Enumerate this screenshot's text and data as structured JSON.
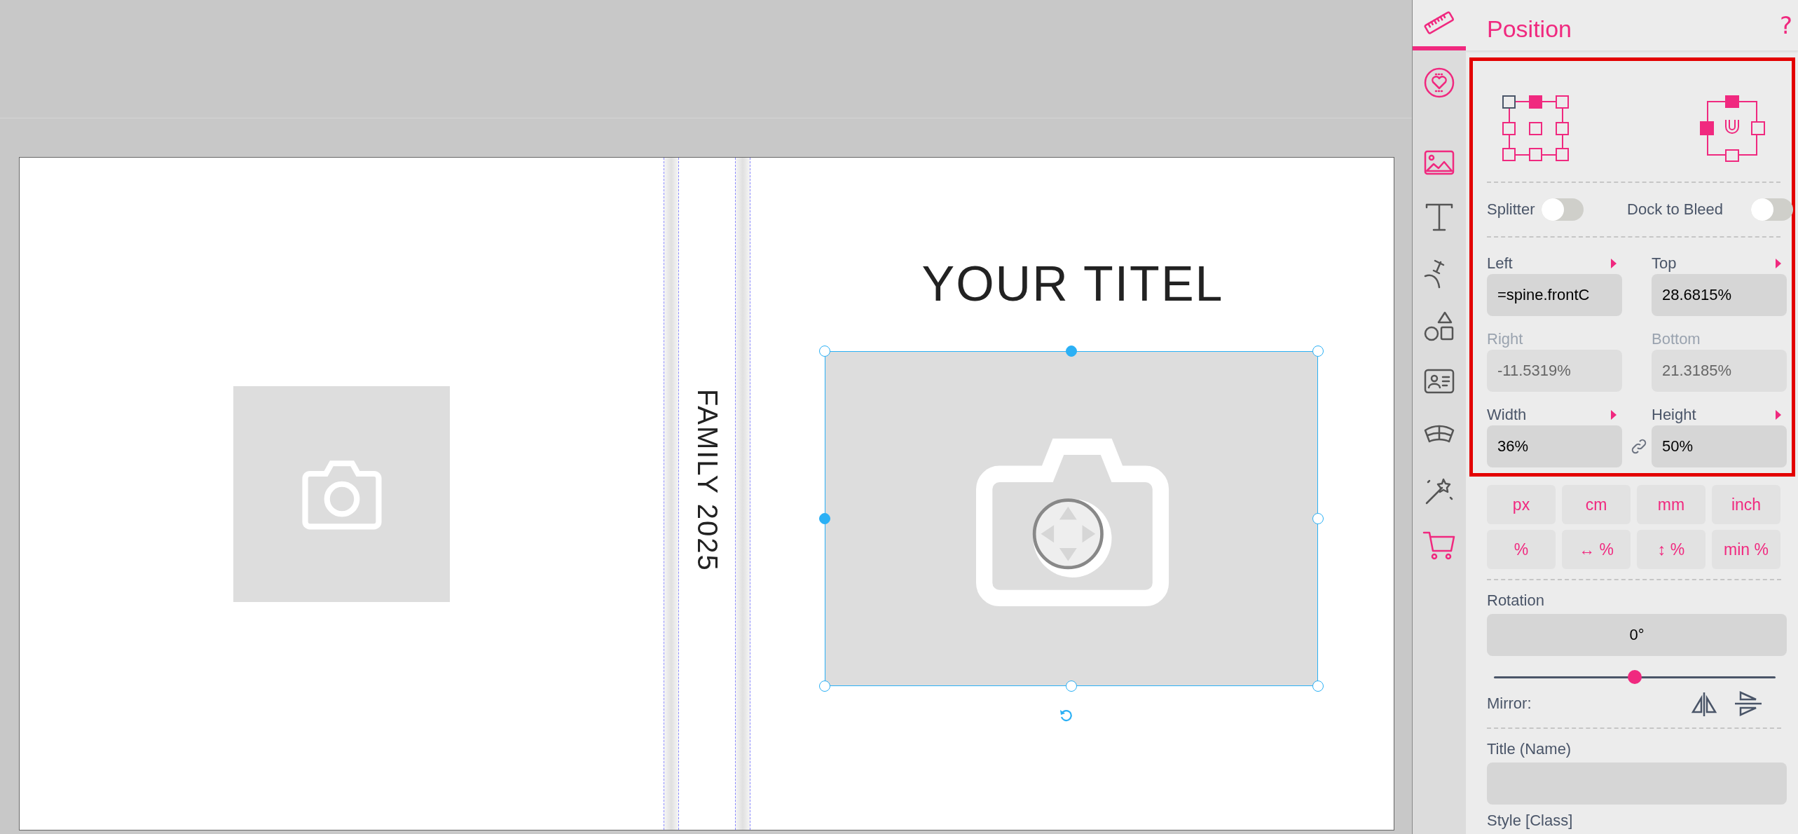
{
  "canvas": {
    "title": "YOUR TITEL",
    "spine_text": "FAMILY 2025"
  },
  "sidebar": {
    "tabs": [
      {
        "kind": "ruler",
        "color": "#f0297f",
        "selected": true
      },
      {
        "kind": "heart",
        "color": "#f0297f",
        "selected": false
      },
      {
        "kind": "image",
        "color": "#f0297f",
        "selected": false
      },
      {
        "kind": "text",
        "color": "#555555",
        "selected": false
      },
      {
        "kind": "curve",
        "color": "#555555",
        "selected": false
      },
      {
        "kind": "shapes",
        "color": "#555555",
        "selected": false
      },
      {
        "kind": "card",
        "color": "#555555",
        "selected": false
      },
      {
        "kind": "bowl",
        "color": "#555555",
        "selected": false
      },
      {
        "kind": "wand",
        "color": "#555555",
        "selected": false
      },
      {
        "kind": "cart",
        "color": "#f0297f",
        "selected": false
      }
    ]
  },
  "panel": {
    "title": "Position",
    "help": "?",
    "toggles": [
      {
        "label": "Splitter",
        "on": false
      },
      {
        "label": "Dock to Bleed",
        "on": false
      }
    ],
    "fields": [
      {
        "label": "Left",
        "value": "=spine.frontC",
        "disabled": false,
        "has_menu": true
      },
      {
        "label": "Top",
        "value": "28.6815%",
        "disabled": false,
        "has_menu": true
      },
      {
        "label": "Right",
        "value": "-11.5319%",
        "disabled": true,
        "has_menu": false
      },
      {
        "label": "Bottom",
        "value": "21.3185%",
        "disabled": true,
        "has_menu": false
      },
      {
        "label": "Width",
        "value": "36%",
        "disabled": false,
        "has_menu": true
      },
      {
        "label": "Height",
        "value": "50%",
        "disabled": false,
        "has_menu": true
      }
    ],
    "units": [
      "px",
      "cm",
      "mm",
      "inch",
      "%",
      "↔ %",
      "↕ %",
      "min %"
    ],
    "rotation": {
      "label": "Rotation",
      "value": "0°",
      "level": 0.5
    },
    "mirror": {
      "label": "Mirror:"
    },
    "name_field": {
      "label": "Title (Name)"
    },
    "style_label": "Style [Class]"
  }
}
